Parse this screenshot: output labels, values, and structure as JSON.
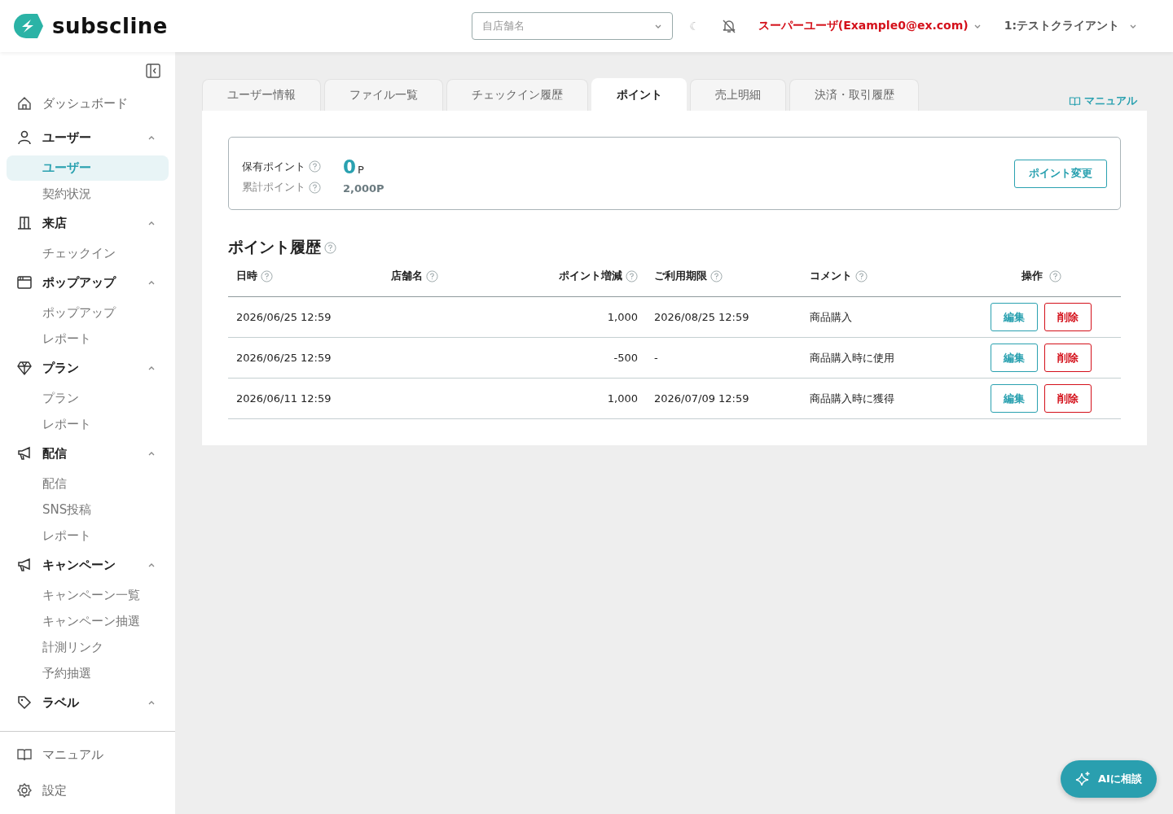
{
  "header": {
    "logo": "subscline",
    "store_select": {
      "placeholder": "自店舗名"
    },
    "moon": "☾",
    "user": "スーパーユーザ(Example0@ex.com)",
    "client": "1:テストクライアント"
  },
  "sidebar": {
    "items": [
      {
        "label": "ダッシュボード",
        "kind": "link"
      },
      {
        "label": "ユーザー",
        "kind": "group",
        "expanded": true,
        "children": [
          {
            "label": "ユーザー",
            "selected": true
          },
          {
            "label": "契約状況",
            "selected": false
          }
        ]
      },
      {
        "label": "来店",
        "kind": "group",
        "expanded": true,
        "children": [
          {
            "label": "チェックイン",
            "selected": false
          }
        ]
      },
      {
        "label": "ポップアップ",
        "kind": "group",
        "expanded": true,
        "children": [
          {
            "label": "ポップアップ",
            "selected": false
          },
          {
            "label": "レポート",
            "selected": false
          }
        ]
      },
      {
        "label": "プラン",
        "kind": "group",
        "expanded": true,
        "children": [
          {
            "label": "プラン",
            "selected": false
          },
          {
            "label": "レポート",
            "selected": false
          }
        ]
      },
      {
        "label": "配信",
        "kind": "group",
        "expanded": true,
        "children": [
          {
            "label": "配信",
            "selected": false
          },
          {
            "label": "SNS投稿",
            "selected": false
          },
          {
            "label": "レポート",
            "selected": false
          }
        ]
      },
      {
        "label": "キャンペーン",
        "kind": "group",
        "expanded": true,
        "children": [
          {
            "label": "キャンペーン一覧",
            "selected": false
          },
          {
            "label": "キャンペーン抽選",
            "selected": false
          },
          {
            "label": "計測リンク",
            "selected": false
          },
          {
            "label": "予約抽選",
            "selected": false
          }
        ]
      },
      {
        "label": "ラベル",
        "kind": "group",
        "expanded": true
      }
    ],
    "footer": [
      {
        "label": "マニュアル"
      },
      {
        "label": "設定"
      }
    ]
  },
  "tabs": [
    {
      "label": "ユーザー情報",
      "selected": false
    },
    {
      "label": "ファイル一覧",
      "selected": false
    },
    {
      "label": "チェックイン履歴",
      "selected": false
    },
    {
      "label": "ポイント",
      "selected": true
    },
    {
      "label": "売上明細",
      "selected": false
    },
    {
      "label": "決済・取引履歴",
      "selected": false
    }
  ],
  "manual_link": "マニュアル",
  "points": {
    "held_label": "保有ポイント",
    "held_value": "0",
    "held_unit": "P",
    "total_label": "累計ポイント",
    "total_value": "2,000P",
    "change_button": "ポイント変更"
  },
  "history": {
    "title": "ポイント履歴",
    "columns": [
      "日時",
      "店舗名",
      "ポイント増減",
      "ご利用期限",
      "コメント",
      "操作"
    ],
    "rows": [
      {
        "date": "2026/06/25 12:59",
        "store": "",
        "points": "1,000",
        "expiry": "2026/08/25 12:59",
        "comment": "商品購入",
        "edit": "編集",
        "delete": "削除"
      },
      {
        "date": "2026/06/25 12:59",
        "store": "",
        "points": "-500",
        "expiry": "-",
        "comment": "商品購入時に使用",
        "edit": "編集",
        "delete": "削除"
      },
      {
        "date": "2026/06/11 12:59",
        "store": "",
        "points": "1,000",
        "expiry": "2026/07/09 12:59",
        "comment": "商品購入時に獲得",
        "edit": "編集",
        "delete": "削除"
      }
    ]
  },
  "ai_button": "AIに相談"
}
